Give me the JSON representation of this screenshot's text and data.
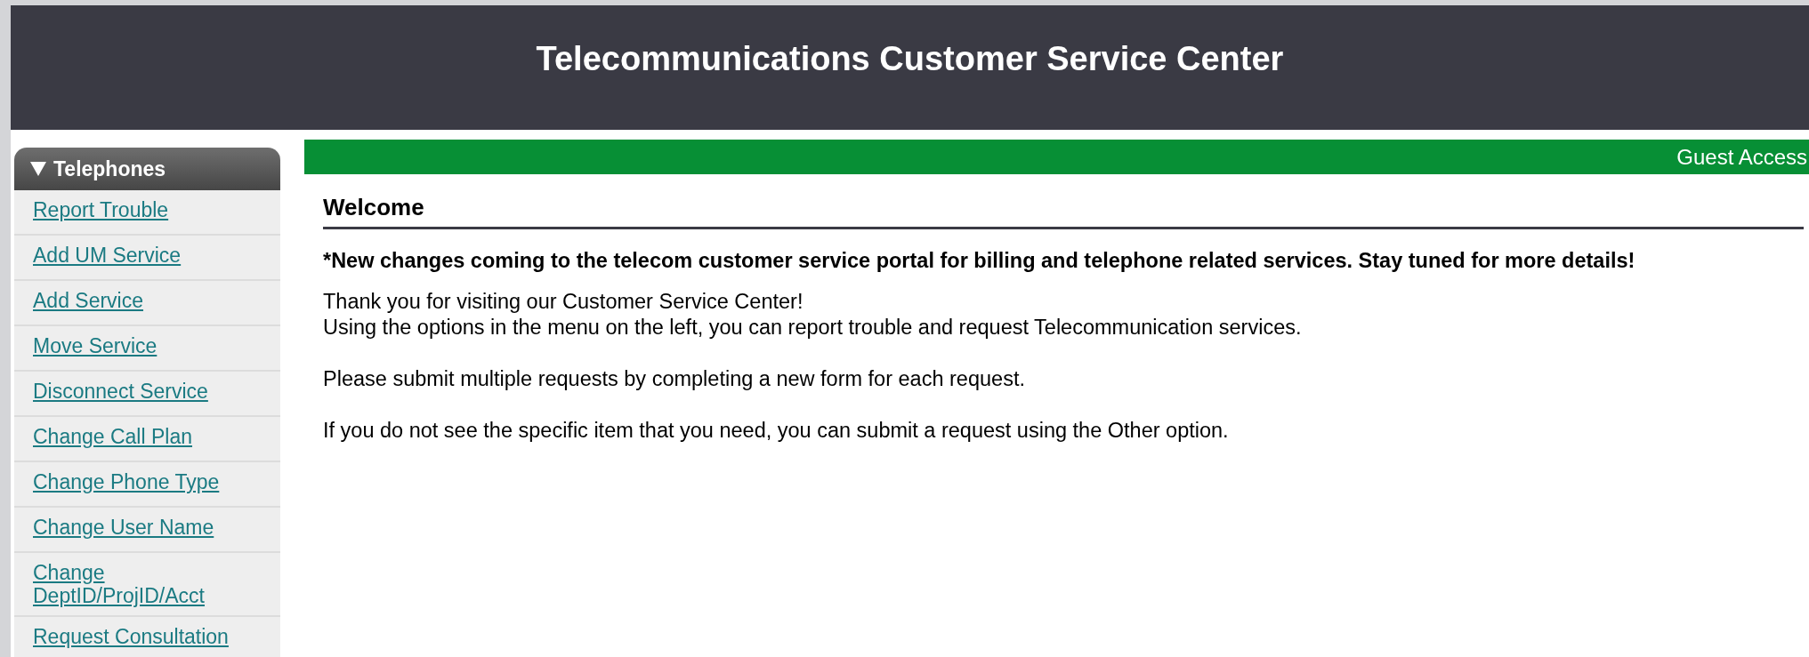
{
  "header": {
    "title": "Telecommunications Customer Service Center"
  },
  "sidebar": {
    "title": "Telephones",
    "expanded": true,
    "items": [
      {
        "label": "Report Trouble"
      },
      {
        "label": "Add UM Service"
      },
      {
        "label": "Add Service"
      },
      {
        "label": "Move Service"
      },
      {
        "label": "Disconnect Service"
      },
      {
        "label": "Change Call Plan"
      },
      {
        "label": "Change Phone Type"
      },
      {
        "label": "Change User Name"
      },
      {
        "label": "Change DeptID/ProjID/Acct"
      },
      {
        "label": "Request Consultation"
      }
    ]
  },
  "status_bar": {
    "text": "Guest Access"
  },
  "content": {
    "heading": "Welcome",
    "notice": "*New changes coming to the telecom customer service portal for billing and telephone related services. Stay tuned for more details!",
    "paragraphs": [
      {
        "lines": [
          "Thank you for visiting our Customer Service Center!",
          "Using the options in the menu on the left, you can report trouble and request Telecommunication services."
        ]
      },
      {
        "lines": [
          "Please submit multiple requests by completing a new form for each request."
        ]
      },
      {
        "lines": [
          "If you do not see the specific item that you need, you can submit a request using the Other option."
        ]
      }
    ]
  }
}
